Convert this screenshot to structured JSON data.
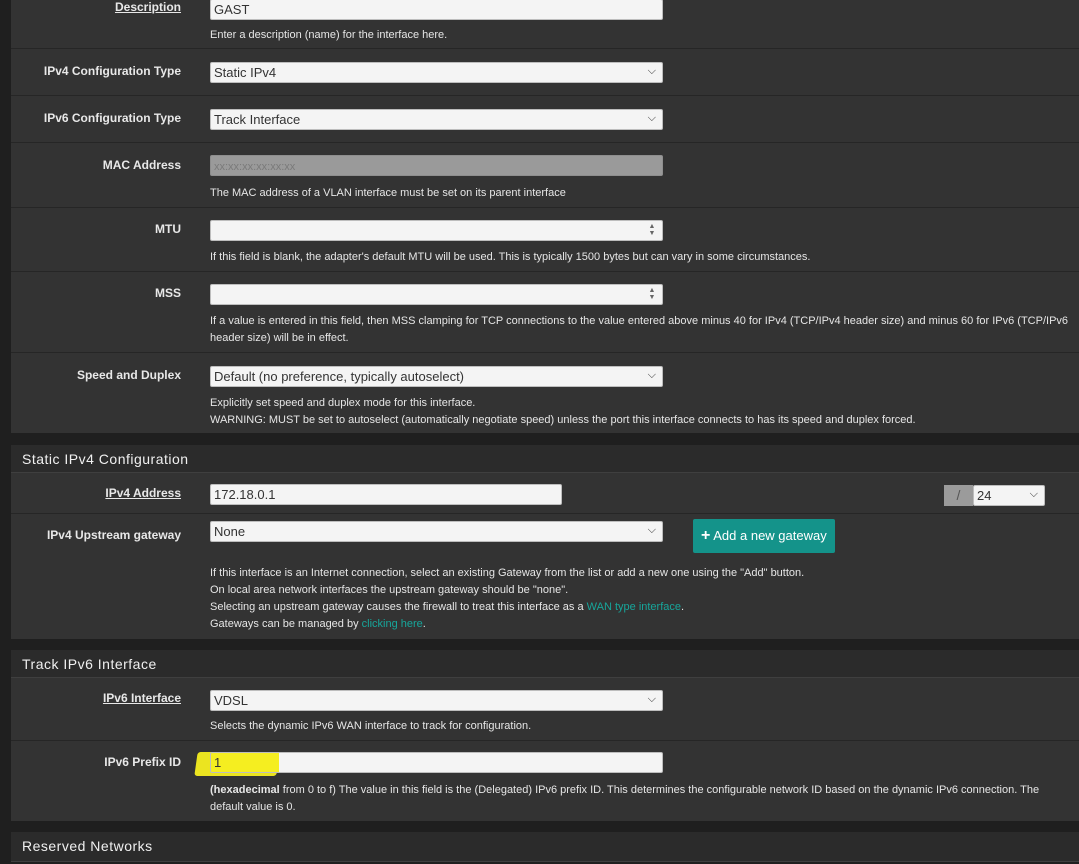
{
  "description": {
    "label": "Description",
    "value": "GAST",
    "help": "Enter a description (name) for the interface here."
  },
  "ipv4_type": {
    "label": "IPv4 Configuration Type",
    "value": "Static IPv4"
  },
  "ipv6_type": {
    "label": "IPv6 Configuration Type",
    "value": "Track Interface"
  },
  "mac": {
    "label": "MAC Address",
    "placeholder": "xx:xx:xx:xx:xx:xx",
    "help": "The MAC address of a VLAN interface must be set on its parent interface"
  },
  "mtu": {
    "label": "MTU",
    "value": "",
    "help": "If this field is blank, the adapter's default MTU will be used. This is typically 1500 bytes but can vary in some circumstances."
  },
  "mss": {
    "label": "MSS",
    "value": "",
    "help_line1": "If a value is entered in this field, then MSS clamping for TCP connections to the value entered above minus 40 for IPv4 (TCP/IPv4 header size) and minus 60 for IPv6 (TCP/IPv6",
    "help_line2": "header size) will be in effect."
  },
  "speed": {
    "label": "Speed and Duplex",
    "value": "Default (no preference, typically autoselect)",
    "help_line1": "Explicitly set speed and duplex mode for this interface.",
    "help_line2": "WARNING: MUST be set to autoselect (automatically negotiate speed) unless the port this interface connects to has its speed and duplex forced."
  },
  "static_ipv4": {
    "title": "Static IPv4 Configuration",
    "address_label": "IPv4 Address",
    "address_value": "172.18.0.1",
    "slash": "/",
    "cidr_value": "24",
    "gateway_label": "IPv4 Upstream gateway",
    "gateway_value": "None",
    "add_gateway_button": "Add a new gateway",
    "help_line1": "If this interface is an Internet connection, select an existing Gateway from the list or add a new one using the \"Add\" button.",
    "help_line2": "On local area network interfaces the upstream gateway should be \"none\".",
    "help_line3_pre": "Selecting an upstream gateway causes the firewall to treat this interface as a ",
    "help_line3_link": "WAN type interface",
    "help_line3_post": ".",
    "help_line4_pre": "Gateways can be managed by ",
    "help_line4_link": "clicking here",
    "help_line4_post": "."
  },
  "track_ipv6": {
    "title": "Track IPv6 Interface",
    "interface_label": "IPv6 Interface",
    "interface_value": "VDSL",
    "interface_help": "Selects the dynamic IPv6 WAN interface to track for configuration.",
    "prefix_label": "IPv6 Prefix ID",
    "prefix_value": "1",
    "prefix_help_bold": "(hexadecimal",
    "prefix_help_rest": " from 0 to f) The value in this field is the (Delegated) IPv6 prefix ID. This determines the configurable network ID based on the dynamic IPv6 connection. The",
    "prefix_help_line2": "default value is 0."
  },
  "reserved": {
    "title": "Reserved Networks"
  },
  "colors": {
    "accent": "#14938a",
    "link": "#17a69b",
    "highlight": "#f5ee20"
  }
}
